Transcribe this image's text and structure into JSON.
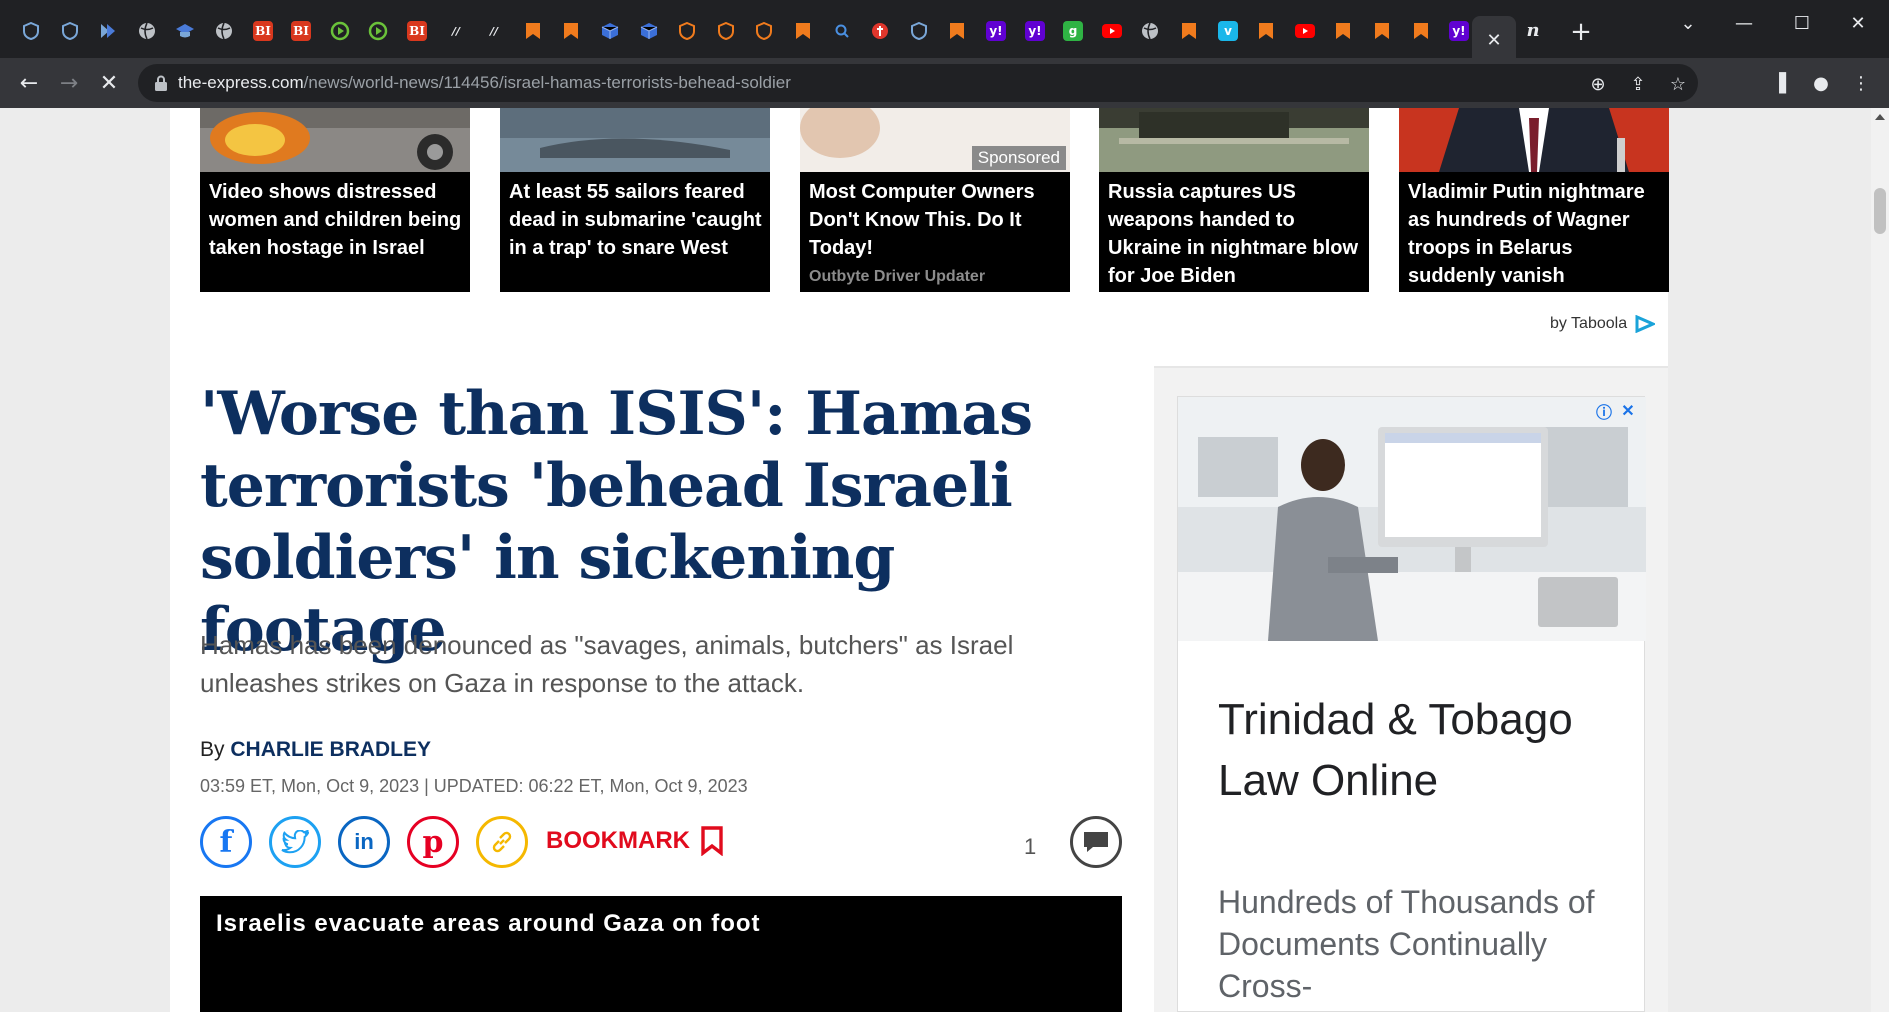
{
  "browser": {
    "tabs": [
      {
        "icon": "shield-icon",
        "color": "#7aa7d8"
      },
      {
        "icon": "shield-icon",
        "color": "#7aa7d8"
      },
      {
        "icon": "arrow-icon",
        "color": "#7aa7d8"
      },
      {
        "icon": "globe-icon",
        "color": "#bdc1c6"
      },
      {
        "icon": "cap-icon",
        "color": "#4a7bd9"
      },
      {
        "icon": "globe-icon",
        "color": "#bdc1c6"
      },
      {
        "icon": "bi-icon",
        "color": "#d9381e",
        "text": "BI"
      },
      {
        "icon": "bi-icon",
        "color": "#d9381e",
        "text": "BI"
      },
      {
        "icon": "play-icon",
        "color": "#6ac23a"
      },
      {
        "icon": "play-icon",
        "color": "#6ac23a"
      },
      {
        "icon": "bi-icon",
        "color": "#d9381e",
        "text": "BI"
      },
      {
        "icon": "news-icon",
        "color": "#e8eaed"
      },
      {
        "icon": "news-icon",
        "color": "#e8eaed"
      },
      {
        "icon": "bookmark-icon",
        "color": "#f07b1d"
      },
      {
        "icon": "bookmark-icon",
        "color": "#f07b1d"
      },
      {
        "icon": "cube-icon",
        "color": "#3b6fd8"
      },
      {
        "icon": "cube-icon",
        "color": "#3b6fd8"
      },
      {
        "icon": "shield-icon",
        "color": "#f07b1d"
      },
      {
        "icon": "shield-icon",
        "color": "#f07b1d"
      },
      {
        "icon": "shield-icon",
        "color": "#f07b1d"
      },
      {
        "icon": "bookmark-icon",
        "color": "#f07b1d"
      },
      {
        "icon": "search-icon",
        "color": "#4a90e2"
      },
      {
        "icon": "pin-icon",
        "color": "#e0362c"
      },
      {
        "icon": "shield-icon",
        "color": "#7aa7d8"
      },
      {
        "icon": "bookmark-icon",
        "color": "#f07b1d"
      },
      {
        "icon": "yahoo-icon",
        "color": "#6001d2",
        "text": "y!"
      },
      {
        "icon": "yahoo-icon",
        "color": "#6001d2",
        "text": "y!"
      },
      {
        "icon": "g-icon",
        "color": "#2fb344",
        "text": "g"
      },
      {
        "icon": "youtube-icon",
        "color": "#ff0000"
      },
      {
        "icon": "globe-icon",
        "color": "#bdc1c6"
      },
      {
        "icon": "bookmark-icon",
        "color": "#f07b1d"
      },
      {
        "icon": "vimeo-icon",
        "color": "#1ab7ea",
        "text": "v"
      },
      {
        "icon": "bookmark-icon",
        "color": "#f07b1d"
      },
      {
        "icon": "youtube-icon",
        "color": "#ff0000"
      },
      {
        "icon": "bookmark-icon",
        "color": "#f07b1d"
      },
      {
        "icon": "bookmark-icon",
        "color": "#f07b1d"
      },
      {
        "icon": "bookmark-icon",
        "color": "#f07b1d"
      },
      {
        "icon": "yahoo-icon",
        "color": "#6001d2",
        "text": "y!"
      }
    ],
    "last_tab_text": "n",
    "url_host": "the-express.com",
    "url_path": "/news/world-news/114456/israel-hamas-terrorists-behead-soldier"
  },
  "recommended": [
    {
      "title": "Video shows distressed women and children being taken hostage in Israel"
    },
    {
      "title": "At least 55 sailors feared dead in submarine 'caught in a trap' to snare West"
    },
    {
      "title": "Most Computer Owners Don't Know This. Do It Today!",
      "sponsored_label": "Sponsored",
      "brand": "Outbyte Driver Updater"
    },
    {
      "title": "Russia captures US weapons handed to Ukraine in nightmare blow for Joe Biden"
    },
    {
      "title": "Vladimir Putin nightmare as hundreds of Wagner troops in Belarus suddenly vanish"
    }
  ],
  "taboola_label": "by Taboola",
  "article": {
    "headline": "'Worse than ISIS': Hamas terrorists 'behead Israeli soldiers' in sickening footage",
    "standfirst": "Hamas has been denounced as \"savages, animals, butchers\" as Israel unleashes strikes on Gaza in response to the attack.",
    "by_prefix": "By",
    "author": "CHARLIE BRADLEY",
    "dates": "03:59 ET, Mon, Oct 9, 2023 | UPDATED: 06:22 ET, Mon, Oct 9, 2023",
    "bookmark_label": "BOOKMARK",
    "comment_count": "1",
    "video_title": "Israelis evacuate areas around Gaza on foot"
  },
  "ad": {
    "headline": "Trinidad & Tobago Law Online",
    "body": "Hundreds of Thousands of Documents Continually Cross-"
  },
  "colors": {
    "headline": "#0d2f5f",
    "bookmark": "#e10b1d",
    "facebook": "#1877f2",
    "twitter": "#1da1f2",
    "linkedin": "#0a66c2",
    "pinterest": "#e60023",
    "link": "#f5b800"
  }
}
